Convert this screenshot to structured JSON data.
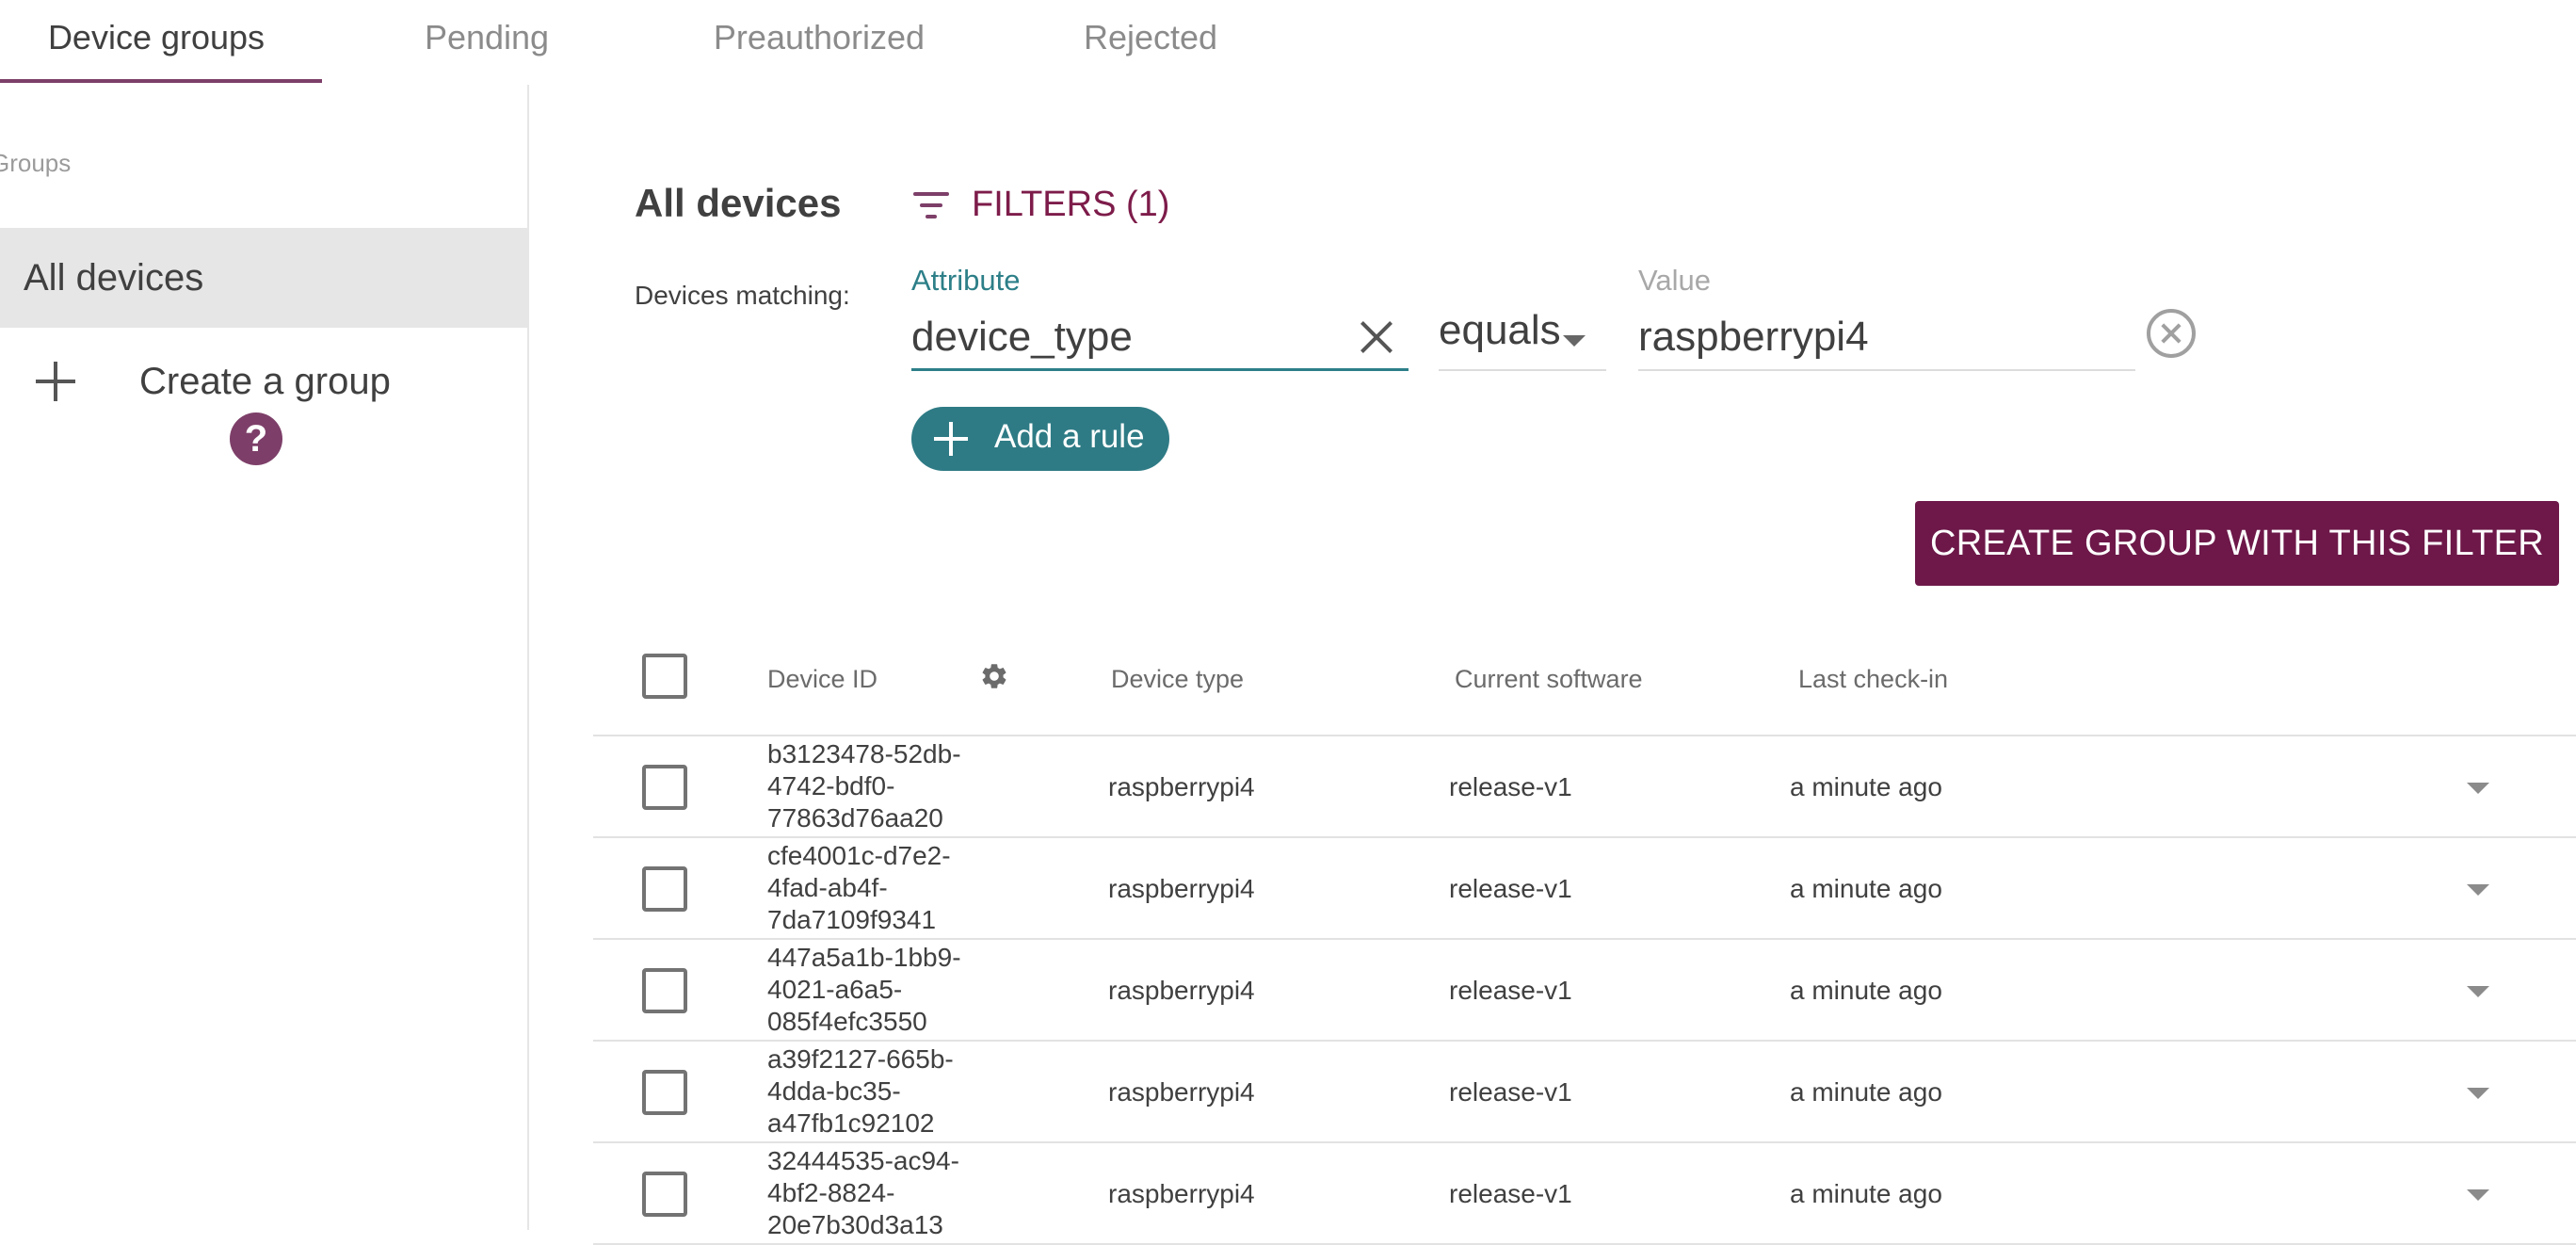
{
  "tabs": [
    {
      "label": "Device groups",
      "active": true
    },
    {
      "label": "Pending",
      "active": false
    },
    {
      "label": "Preauthorized",
      "active": false
    },
    {
      "label": "Rejected",
      "active": false
    }
  ],
  "sidebar": {
    "heading": "Groups",
    "selected_group": "All devices",
    "create_group_label": "Create a group",
    "help_icon": "?"
  },
  "main": {
    "title": "All devices",
    "filters_label": "FILTERS (1)",
    "matching_label": "Devices matching:"
  },
  "filter": {
    "attribute_label": "Attribute",
    "attribute_value": "device_type",
    "operator": "equals",
    "value_label": "Value",
    "value": "raspberrypi4",
    "add_rule_label": "Add a rule",
    "create_group_label": "CREATE GROUP WITH THIS FILTER"
  },
  "table": {
    "headers": {
      "device_id": "Device ID",
      "device_type": "Device type",
      "current_software": "Current software",
      "last_checkin": "Last check-in"
    },
    "rows": [
      {
        "id_lines": [
          "b3123478-52db-",
          "4742-bdf0-",
          "77863d76aa20"
        ],
        "device_type": "raspberrypi4",
        "software": "release-v1",
        "checkin": "a minute ago"
      },
      {
        "id_lines": [
          "cfe4001c-d7e2-",
          "4fad-ab4f-",
          "7da7109f9341"
        ],
        "device_type": "raspberrypi4",
        "software": "release-v1",
        "checkin": "a minute ago"
      },
      {
        "id_lines": [
          "447a5a1b-1bb9-",
          "4021-a6a5-",
          "085f4efc3550"
        ],
        "device_type": "raspberrypi4",
        "software": "release-v1",
        "checkin": "a minute ago"
      },
      {
        "id_lines": [
          "a39f2127-665b-",
          "4dda-bc35-",
          "a47fb1c92102"
        ],
        "device_type": "raspberrypi4",
        "software": "release-v1",
        "checkin": "a minute ago"
      },
      {
        "id_lines": [
          "32444535-ac94-",
          "4bf2-8824-",
          "20e7b30d3a13"
        ],
        "device_type": "raspberrypi4",
        "software": "release-v1",
        "checkin": "a minute ago"
      }
    ]
  },
  "colors": {
    "accent": "#7d3f69",
    "primary_button": "#6d1849",
    "teal": "#2e7b85"
  },
  "icons": {
    "filter": "filter-list-icon",
    "clear": "close-icon",
    "remove_rule": "close-circle-icon",
    "add": "plus-icon",
    "settings": "gear-icon",
    "expand": "chevron-down-icon",
    "help": "help-icon"
  }
}
